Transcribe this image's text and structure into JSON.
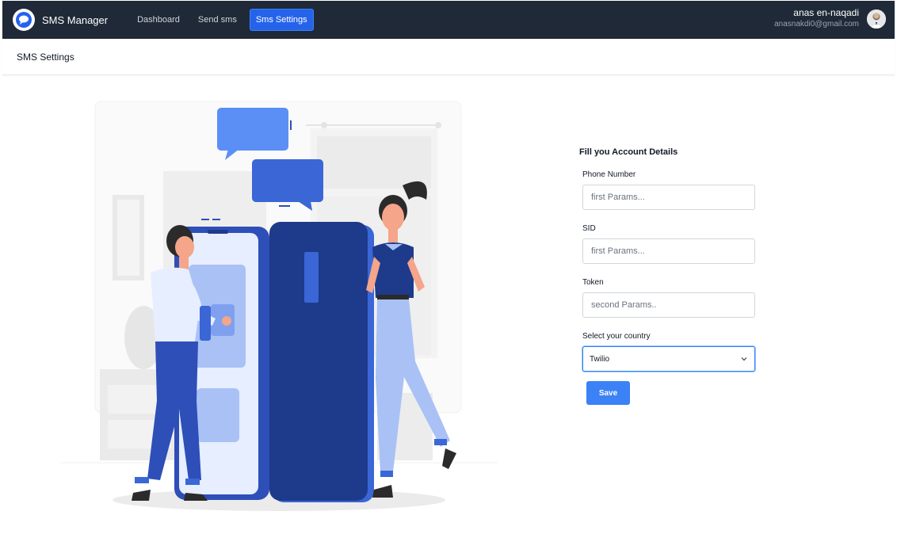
{
  "navbar": {
    "brand_name": "SMS Manager",
    "brand_icon": "chat-bubble-icon",
    "links": [
      {
        "label": "Dashboard",
        "active": false
      },
      {
        "label": "Send sms",
        "active": false
      },
      {
        "label": "Sms Settings",
        "active": true
      }
    ],
    "user": {
      "name": "anas en-naqadi",
      "email": "anasnakdi0@gmail.com",
      "avatar": "user-avatar"
    },
    "accent_color": "#2563eb",
    "background_color": "#1f2937"
  },
  "page": {
    "title": "SMS Settings"
  },
  "form": {
    "title": "Fill you Account Details",
    "fields": [
      {
        "label": "Phone Number",
        "placeholder": "first Params...",
        "value": ""
      },
      {
        "label": "SID",
        "placeholder": "first Params...",
        "value": ""
      },
      {
        "label": "Token",
        "placeholder": "second Params..",
        "value": ""
      }
    ],
    "country": {
      "label": "Select your country",
      "selected": "Twilio",
      "icon": "chevron-down-icon"
    },
    "save_label": "Save"
  },
  "illustration": {
    "name": "people-with-phones-illustration",
    "colors": {
      "primary": "#2e4fb8",
      "light": "#a9c1f5",
      "dark": "#1e3a8a",
      "gray": "#ececec"
    }
  }
}
